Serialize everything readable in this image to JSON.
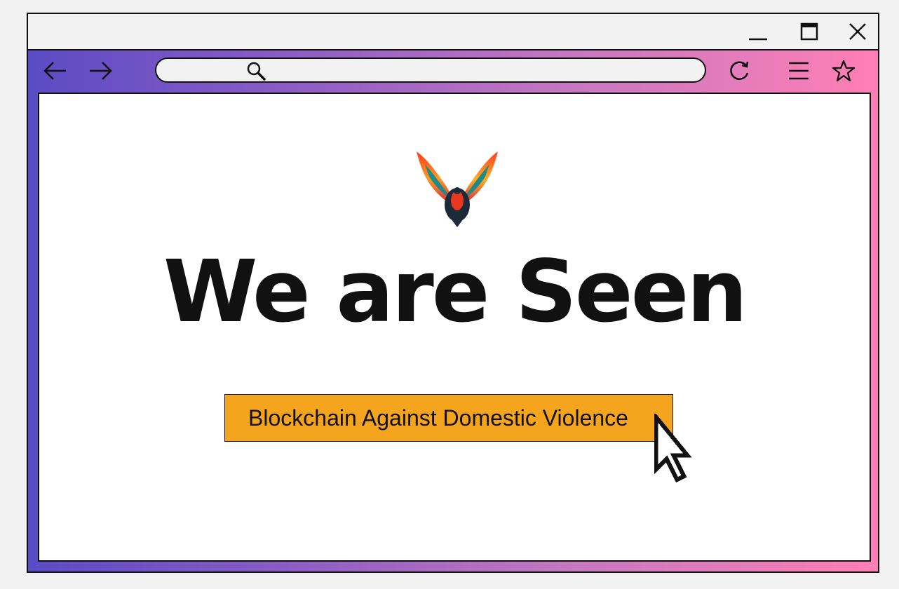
{
  "window": {
    "controls": [
      "minimize-icon",
      "maximize-icon",
      "close-icon"
    ]
  },
  "toolbar": {
    "nav_icons": [
      "arrow-left-icon",
      "arrow-right-icon"
    ],
    "url_placeholder": "",
    "right_icons": [
      "reload-icon",
      "menu-icon",
      "star-icon"
    ]
  },
  "page": {
    "logo": "phoenix-wings-logo",
    "headline": "We are Seen",
    "cta_label": "Blockchain Against Domestic Violence"
  },
  "colors": {
    "gradient_start": "#5b4bc4",
    "gradient_end": "#ff7fb5",
    "cta_background": "#f5a51d",
    "text": "#111111"
  }
}
